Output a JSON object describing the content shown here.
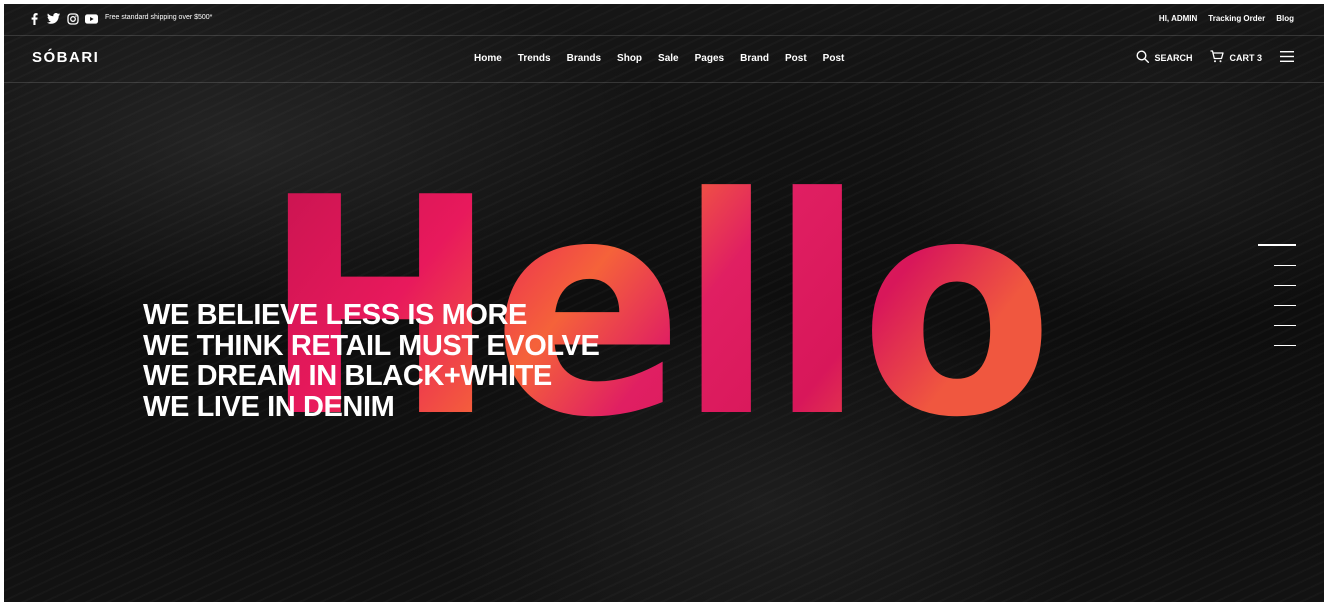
{
  "topbar": {
    "social_icons": [
      "facebook-icon",
      "twitter-icon",
      "instagram-icon",
      "youtube-icon"
    ],
    "shipping_text": "Free standard shipping over $500*",
    "links": {
      "account": "HI, ADMIN",
      "tracking": "Tracking Order",
      "blog": "Blog"
    }
  },
  "header": {
    "logo": "SÓBARI",
    "menu": [
      "Home",
      "Trends",
      "Brands",
      "Shop",
      "Sale",
      "Pages",
      "Brand",
      "Post",
      "Post"
    ],
    "search_label": "SEARCH",
    "cart_label": "CART 3"
  },
  "hero": {
    "big_word": "Hello",
    "lines": [
      "WE BELIEVE LESS IS MORE",
      "WE THINK RETAIL MUST EVOLVE",
      "WE DREAM IN BLACK+WHITE",
      "WE LIVE IN DENIM"
    ],
    "slide_count": 6,
    "active_slide": 1
  },
  "colors": {
    "background": "#121212",
    "text": "#ffffff",
    "accent_pink": "#e8195c",
    "accent_orange": "#f5623a"
  }
}
